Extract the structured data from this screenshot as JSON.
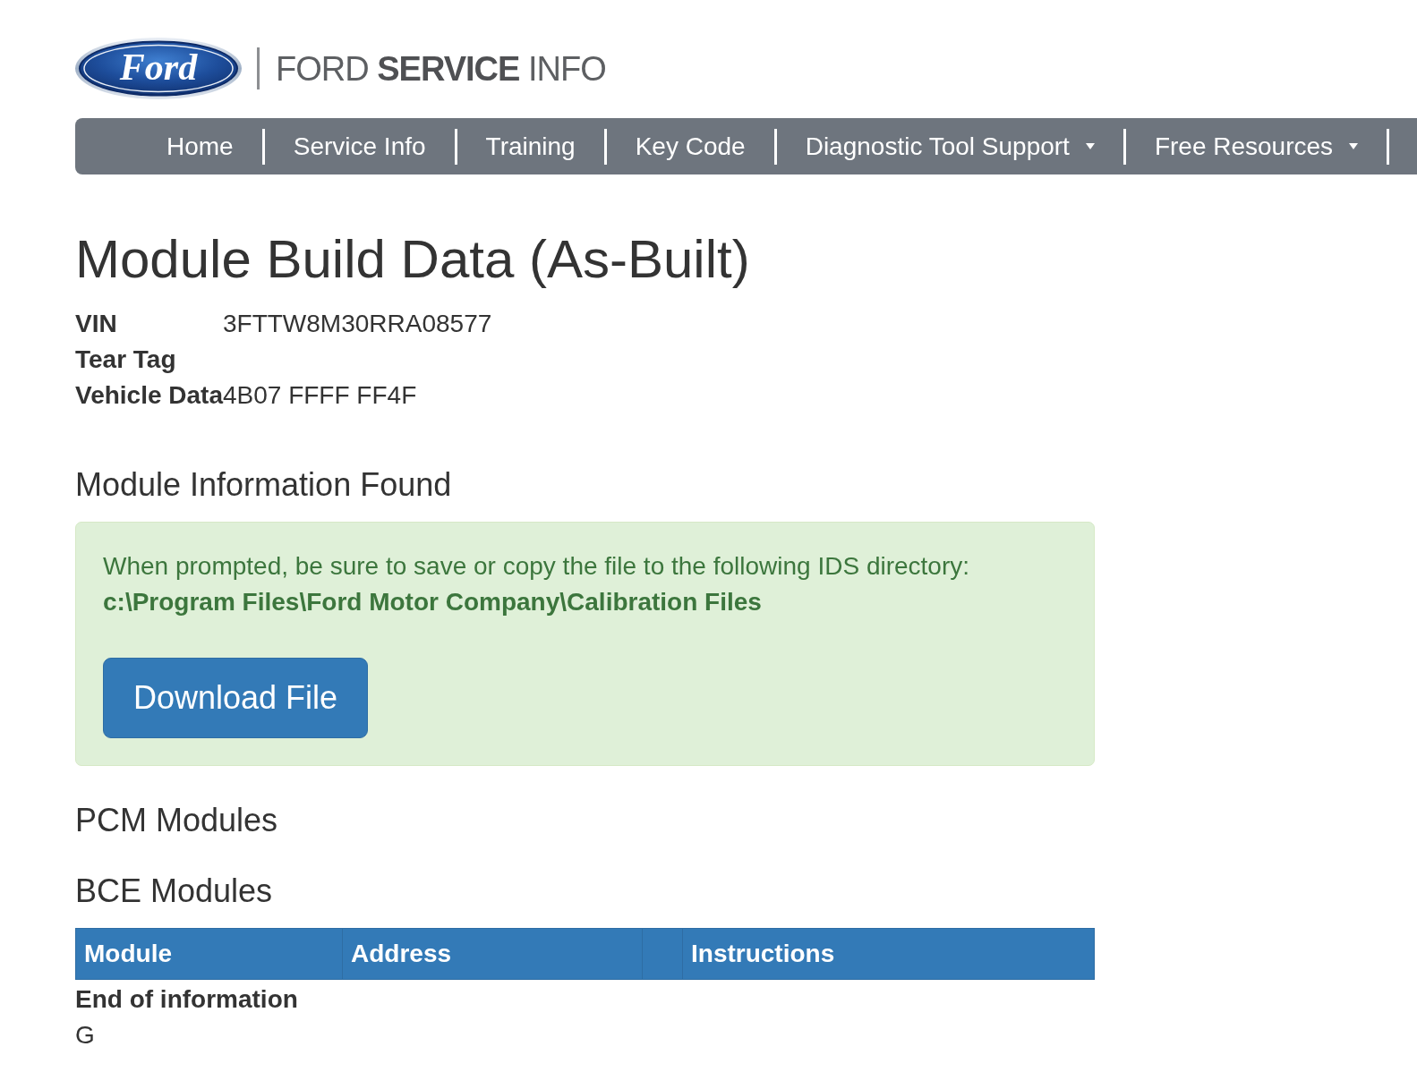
{
  "header": {
    "logo_text": "Ford",
    "site_title": "FORD **SERVICE** INFO"
  },
  "nav": {
    "items": [
      {
        "label": "Home",
        "dropdown": false
      },
      {
        "label": "Service Info",
        "dropdown": false
      },
      {
        "label": "Training",
        "dropdown": false
      },
      {
        "label": "Key Code",
        "dropdown": false
      },
      {
        "label": "Diagnostic Tool Support",
        "dropdown": true
      },
      {
        "label": "Free Resources",
        "dropdown": true
      }
    ]
  },
  "page_title": "Module Build Data (As-Built)",
  "vehicle_fields": [
    {
      "label": "VIN",
      "value": "3FTTW8M30RRA08577"
    },
    {
      "label": "Tear Tag"
    },
    {
      "label": "Vehicle Data",
      "value": "4B07 FFFF FF4F"
    }
  ],
  "module_info": {
    "heading": "Module Information Found",
    "alert": {
      "message": "When prompted, be sure to save or copy the file to the following IDS directory:",
      "directory": "c:\\Program Files\\Ford Motor Company\\Calibration Files",
      "button": "Download File"
    }
  },
  "sections": [
    {
      "heading": "PCM Modules"
    },
    {
      "heading": "BCE Modules",
      "table": {
        "columns": [
          {
            "kind": "text",
            "label": "Module"
          },
          {
            "kind": "text",
            "label": "Address"
          },
          {
            "kind": "empty"
          },
          {
            "kind": "text",
            "label": "Instructions"
          }
        ]
      }
    }
  ],
  "end_note": "End of information",
  "trailing_text": "G"
}
